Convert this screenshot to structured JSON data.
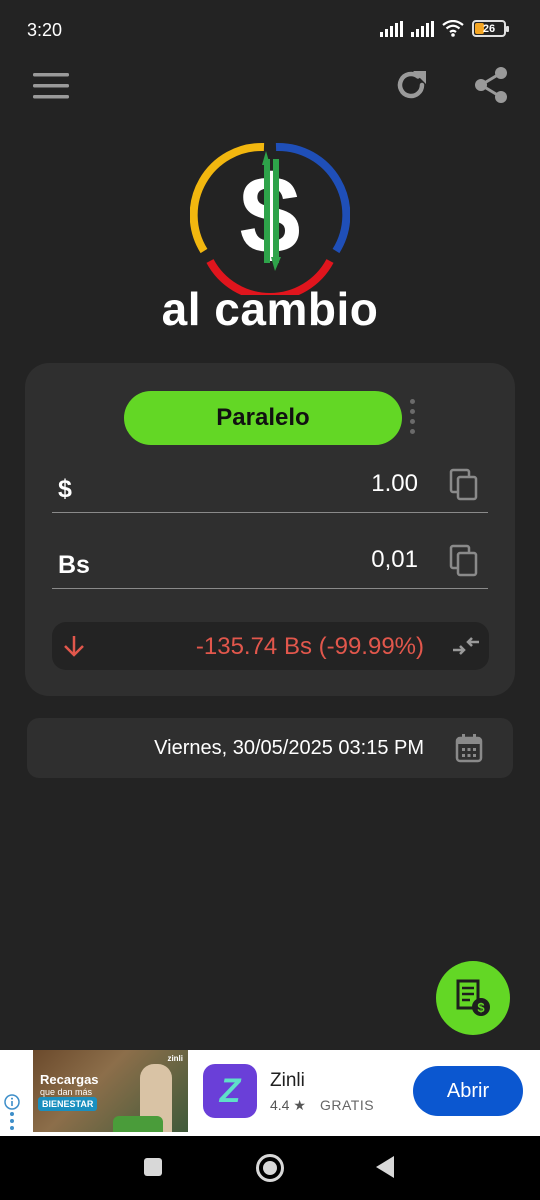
{
  "status_bar": {
    "time": "3:20",
    "battery_level": "26",
    "icons": [
      "signal-icon",
      "signal-icon",
      "wifi-icon",
      "battery-icon"
    ]
  },
  "app_bar": {
    "icons": [
      "menu-icon",
      "refresh-icon",
      "share-icon"
    ]
  },
  "brand": {
    "name": "al cambio",
    "logo_text": "$",
    "logo_colors": {
      "yellow": "#f2b70f",
      "blue": "#1f4fb8",
      "red": "#e0151d",
      "arrow": "#2ea34a"
    }
  },
  "converter": {
    "rate_label": "Paralelo",
    "usd": {
      "symbol": "$",
      "value": "1.00"
    },
    "bs": {
      "symbol": "Bs",
      "value": "0,01"
    },
    "change_text": "-135.74 Bs (-99.99%)",
    "change_color": "#e2574c",
    "icons": [
      "more-vert-icon",
      "copy-icon",
      "copy-icon",
      "arrow-down-icon",
      "swap-icon"
    ]
  },
  "date": {
    "text": "Viernes, 30/05/2025 03:15 PM",
    "icon": "calendar-icon"
  },
  "fab": {
    "icon": "receipt-dollar-icon",
    "color": "#63d725"
  },
  "ad": {
    "image_title": "Recargas",
    "image_subtitle": "que dan más",
    "image_badge": "BIENESTAR",
    "image_logo": "zinli",
    "app_name": "Zinli",
    "rating": "4.4",
    "price": "GRATIS",
    "cta": "Abrir",
    "cta_color": "#0b57d0"
  },
  "nav_bar": {
    "icons": [
      "recents-icon",
      "home-icon",
      "back-icon"
    ]
  },
  "accent_color": "#63d725"
}
